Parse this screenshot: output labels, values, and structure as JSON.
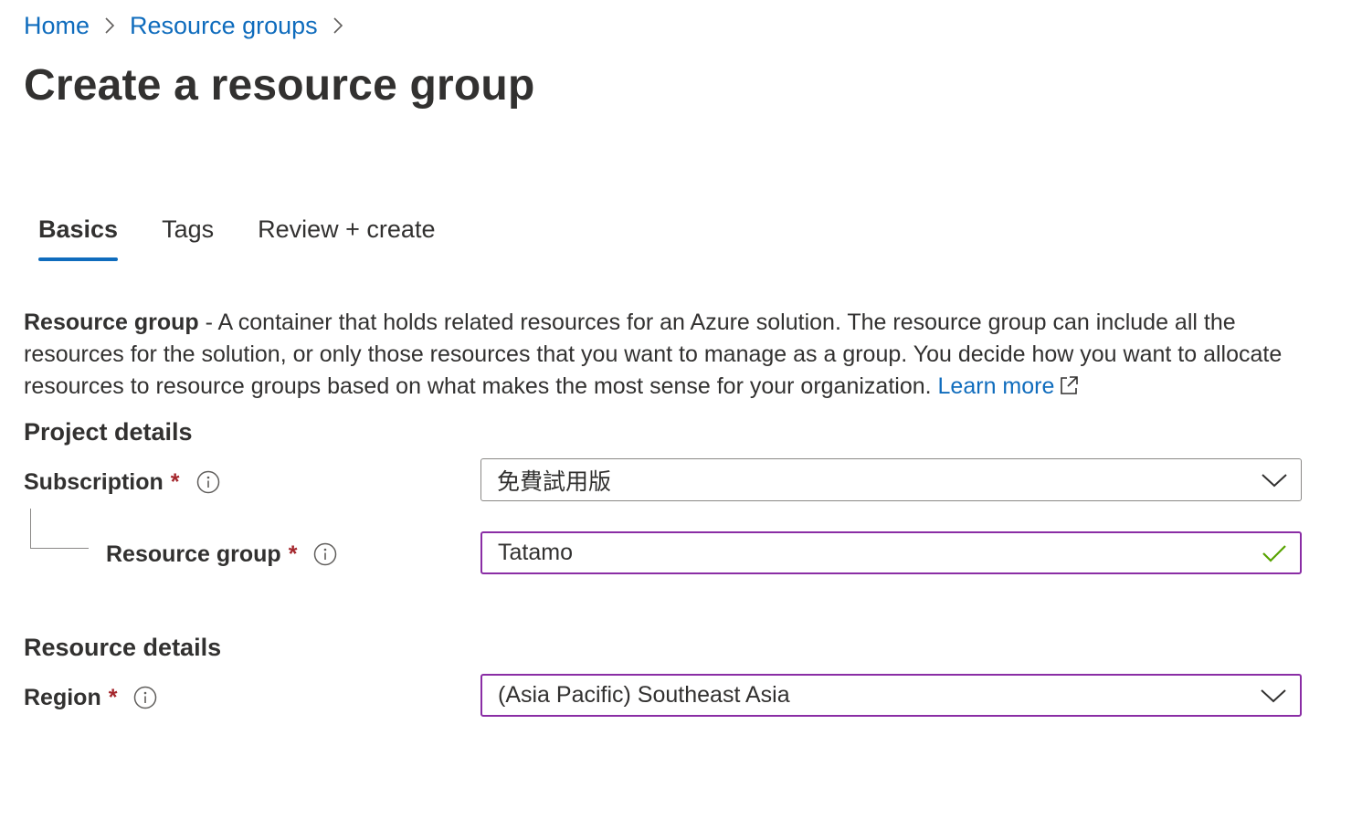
{
  "breadcrumb": {
    "items": [
      {
        "label": "Home"
      },
      {
        "label": "Resource groups"
      }
    ]
  },
  "page": {
    "title": "Create a resource group"
  },
  "tabs": [
    {
      "label": "Basics",
      "active": true
    },
    {
      "label": "Tags",
      "active": false
    },
    {
      "label": "Review + create",
      "active": false
    }
  ],
  "description": {
    "term": "Resource group",
    "text": " - A container that holds related resources for an Azure solution. The resource group can include all the resources for the solution, or only those resources that you want to manage as a group. You decide how you want to allocate resources to resource groups based on what makes the most sense for your organization. ",
    "link_label": "Learn more"
  },
  "project_details": {
    "heading": "Project details",
    "subscription": {
      "label": "Subscription",
      "required_mark": "*",
      "value": "免費試用版"
    },
    "resource_group": {
      "label": "Resource group",
      "required_mark": "*",
      "value": "Tatamo",
      "status": "valid"
    }
  },
  "resource_details": {
    "heading": "Resource details",
    "region": {
      "label": "Region",
      "required_mark": "*",
      "value": "(Asia Pacific) Southeast Asia"
    }
  },
  "colors": {
    "link": "#0f6cbd",
    "text": "#323130",
    "required": "#a4262c",
    "focus_border": "#8a2da5",
    "border": "#8a8886",
    "valid_check": "#57a300"
  },
  "icons": {
    "breadcrumb_separator": "chevron-right-icon",
    "external_link": "external-link-icon",
    "info": "info-icon",
    "dropdown": "chevron-down-icon",
    "valid": "checkmark-icon"
  }
}
